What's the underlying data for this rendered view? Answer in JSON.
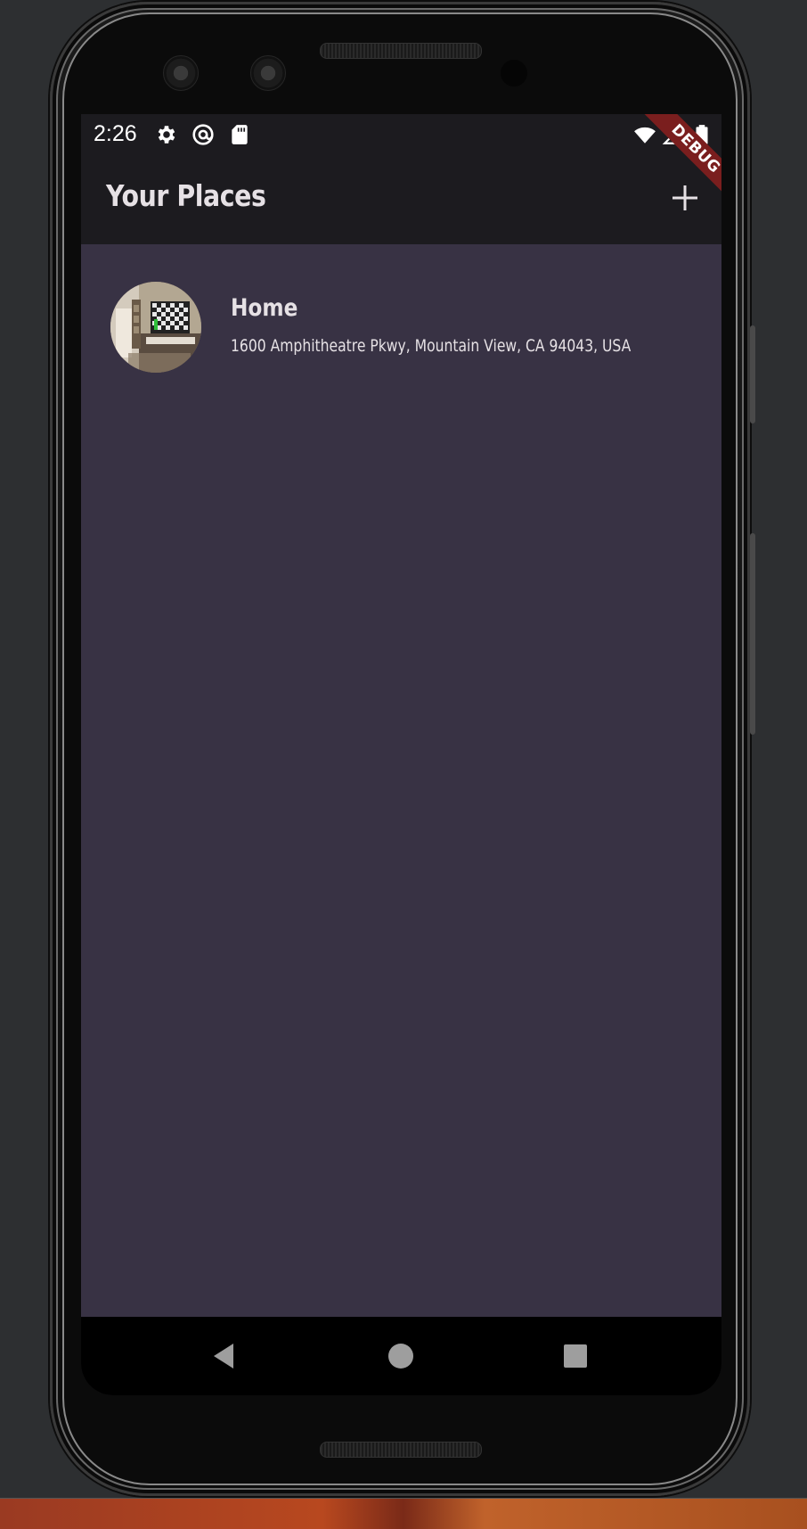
{
  "status_bar": {
    "time": "2:26",
    "left_icons": [
      "gear-icon",
      "at-sign-icon",
      "sd-card-icon"
    ],
    "right_icons": [
      "wifi-icon",
      "signal-icon",
      "battery-icon"
    ]
  },
  "debug_banner": {
    "label": "DEBUG"
  },
  "app_bar": {
    "title": "Your Places",
    "action_icon": "plus-icon"
  },
  "places": [
    {
      "title": "Home",
      "address": "1600 Amphitheatre Pkwy, Mountain View, CA 94043, USA"
    }
  ],
  "nav_bar": {
    "buttons": [
      "back-icon",
      "home-icon",
      "recents-icon"
    ]
  },
  "colors": {
    "surface": "#1c1b1f",
    "background": "#383244",
    "on_surface": "#e6e1e5",
    "debug_banner": "#7a1e1e"
  }
}
